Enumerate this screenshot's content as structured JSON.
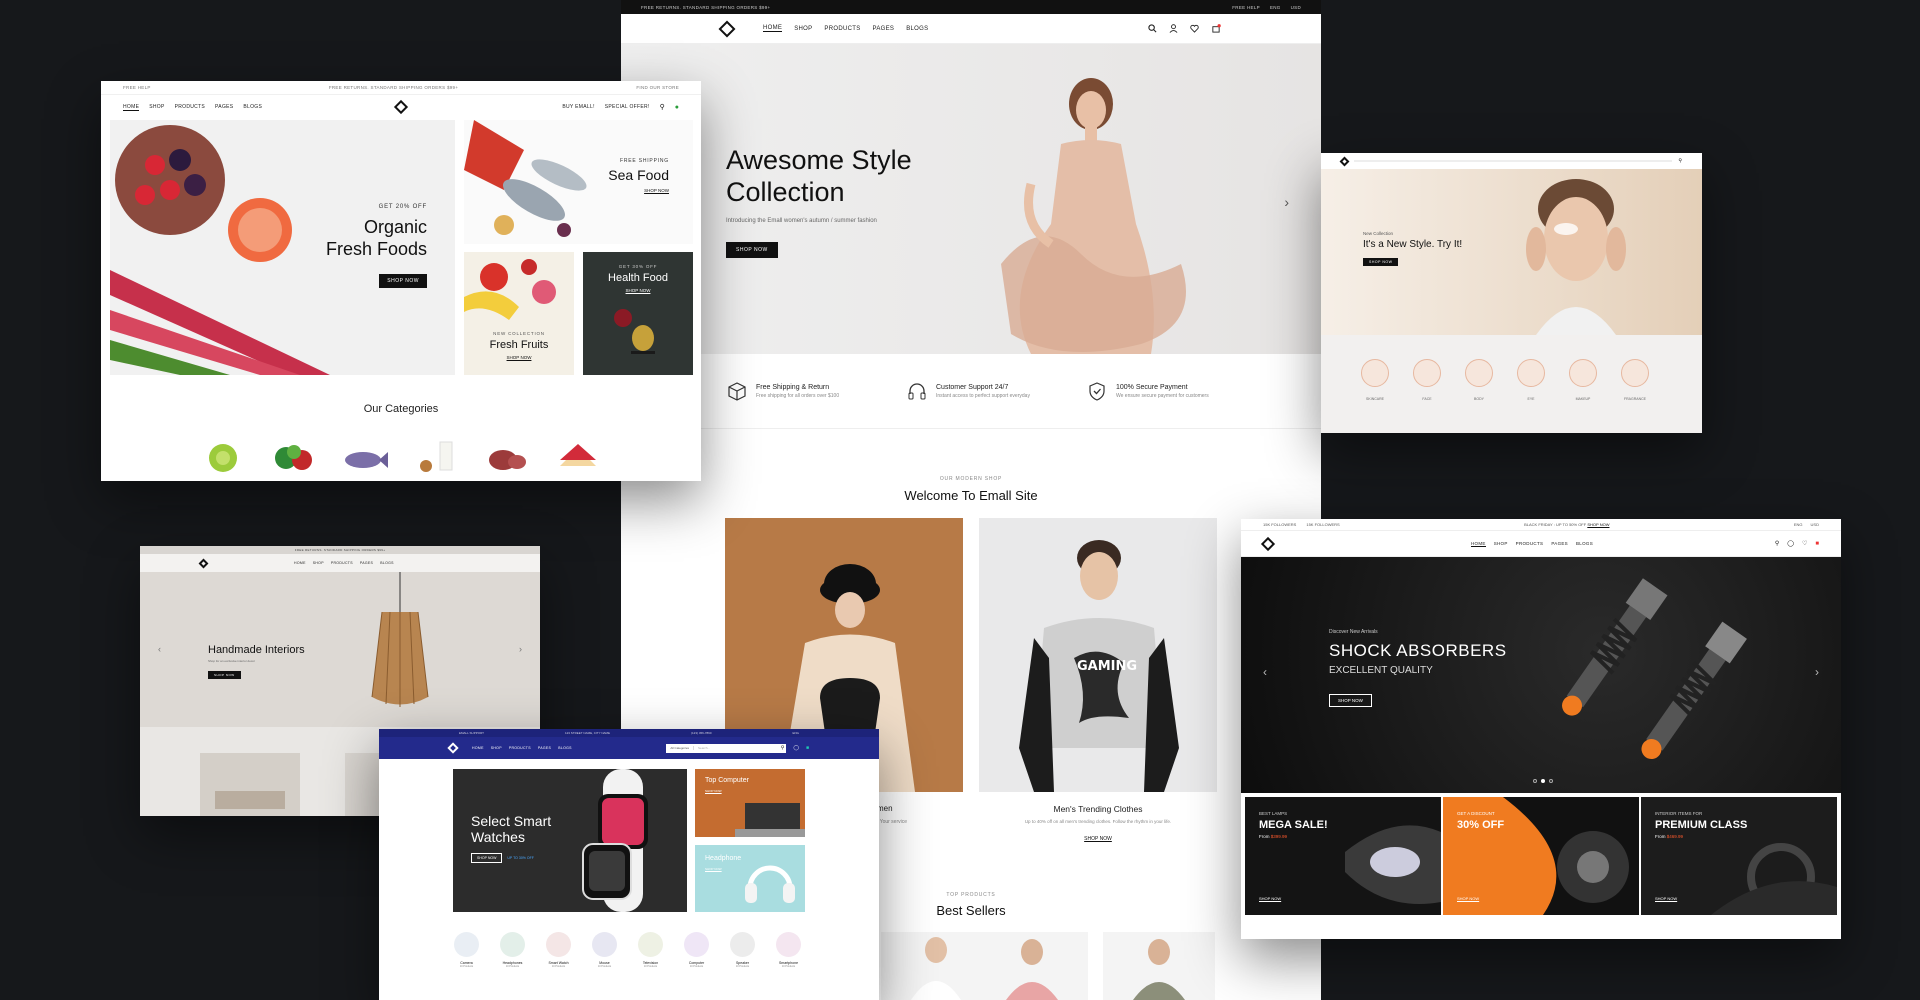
{
  "main": {
    "topbar_text": "FREE RETURNS. STANDARD SHIPPING ORDERS $99+",
    "topbar_phone": "FREE HELP",
    "topbar_lang": "ENG",
    "topbar_cur": "USD",
    "nav": [
      "HOME",
      "SHOP",
      "PRODUCTS",
      "PAGES",
      "BLOGS"
    ],
    "hero_title_1": "Awesome Style",
    "hero_title_2": "Collection",
    "hero_sub": "Introducing the Emall women's autumn / summer fashion",
    "hero_btn": "SHOP NOW",
    "features": [
      {
        "title": "Free Shipping & Return",
        "desc": "Free shipping for all orders over $100"
      },
      {
        "title": "Customer Support 24/7",
        "desc": "Instant access to perfect support everyday"
      },
      {
        "title": "100% Secure Payment",
        "desc": "We ensure secure payment for customers"
      }
    ],
    "section_kicker": "OUR MODERN SHOP",
    "section_title": "Welcome To Emall Site",
    "card_left_title": "men",
    "card_left_desc": ", Your service",
    "card_right_title": "Men's Trending Clothes",
    "card_right_desc": "Up to 40% off on all men's trending clothes. Follow the rhythm in your life.",
    "card_right_btn": "SHOP NOW",
    "best_kicker": "TOP PRODUCTS",
    "best_title": "Best Sellers"
  },
  "organic": {
    "topbar_left": "FREE HELP",
    "topbar_center": "FREE RETURNS. STANDARD SHIPPING ORDERS $99+",
    "topbar_right": "FIND OUR STORE",
    "nav": [
      "HOME",
      "SHOP",
      "PRODUCTS",
      "PAGES",
      "BLOGS"
    ],
    "nav_right": [
      "BUY EMALL!",
      "SPECIAL OFFER!"
    ],
    "hero_kicker": "GET 20% OFF",
    "hero_title_1": "Organic",
    "hero_title_2": "Fresh Foods",
    "hero_btn": "SHOP NOW",
    "seafood_kicker": "FREE SHIPPING",
    "seafood_title": "Sea Food",
    "seafood_btn": "SHOP NOW",
    "fruits_kicker": "NEW COLLECTION",
    "fruits_title": "Fresh Fruits",
    "fruits_btn": "SHOP NOW",
    "health_kicker": "GET 30% OFF",
    "health_title": "Health Food",
    "health_btn": "SHOP NOW",
    "categories_title": "Our Categories"
  },
  "beauty": {
    "kicker": "New Collection",
    "title": "It's a New Style. Try It!",
    "btn": "SHOP NOW",
    "cats": [
      "SKINCARE",
      "FACE",
      "BODY",
      "EYE",
      "MAKEUP",
      "FRAGRANCE"
    ]
  },
  "interior": {
    "topbar": "FREE RETURNS. STANDARD SHIPPING ORDERS $99+",
    "nav": [
      "HOME",
      "SHOP",
      "PRODUCTS",
      "PAGES",
      "BLOGS"
    ],
    "title": "Handmade Interiors",
    "sub": "Shop for an exclusive interior decor",
    "btn": "SHOP NOW"
  },
  "elec": {
    "topbar_left": "EMALL SUPPORT",
    "topbar_addr": "123 STREET NAME, CITY NAME",
    "topbar_phone": "(123) 456-7890",
    "topbar_lang": "ENG",
    "nav": [
      "HOME",
      "SHOP",
      "PRODUCTS",
      "PAGES",
      "BLOGS"
    ],
    "search_cat": "All Categories",
    "search_placeholder": "Search...",
    "hero_title_1": "Select Smart",
    "hero_title_2": "Watches",
    "hero_btn": "SHOP NOW",
    "hero_offer": "UP TO 30% OFF",
    "card1_title": "Top Computer",
    "card1_btn": "SHOP NOW",
    "card2_title": "Headphone",
    "card2_btn": "SHOP NOW",
    "cats": [
      {
        "name": "Camera",
        "count": "10 Products"
      },
      {
        "name": "Headphones",
        "count": "10 Products"
      },
      {
        "name": "Smart Watch",
        "count": "10 Products"
      },
      {
        "name": "Mouse",
        "count": "10 Products"
      },
      {
        "name": "Television",
        "count": "10 Products"
      },
      {
        "name": "Computer",
        "count": "10 Products"
      },
      {
        "name": "Speaker",
        "count": "10 Products"
      },
      {
        "name": "Smartphone",
        "count": "10 Products"
      }
    ]
  },
  "auto": {
    "topbar_fb": "15K FOLLOWERS",
    "topbar_ig": "15K FOLLOWERS",
    "topbar_promo": "BLACK FRIDAY : UP TO 50% OFF",
    "topbar_promo_link": "SHOP NOW",
    "topbar_lang": "ENG",
    "topbar_cur": "USD",
    "nav": [
      "HOME",
      "SHOP",
      "PRODUCTS",
      "PAGES",
      "BLOGS"
    ],
    "hero_kicker": "Discover New Arrivals",
    "hero_title": "SHOCK ABSORBERS",
    "hero_sub": "EXCELLENT QUALITY",
    "hero_btn": "SHOP NOW",
    "banners": [
      {
        "kicker": "BEST LAMPS",
        "title": "MEGA SALE!",
        "price_label": "From",
        "price": "$399.99",
        "btn": "SHOP NOW"
      },
      {
        "kicker": "GET A DISCOUNT",
        "title": "30% OFF",
        "price_label": "",
        "price": "",
        "btn": "SHOP NOW"
      },
      {
        "kicker": "INTERIOR ITEMS FOR",
        "title": "PREMIUM CLASS",
        "price_label": "From",
        "price": "$469.99",
        "btn": "SHOP NOW"
      }
    ]
  }
}
